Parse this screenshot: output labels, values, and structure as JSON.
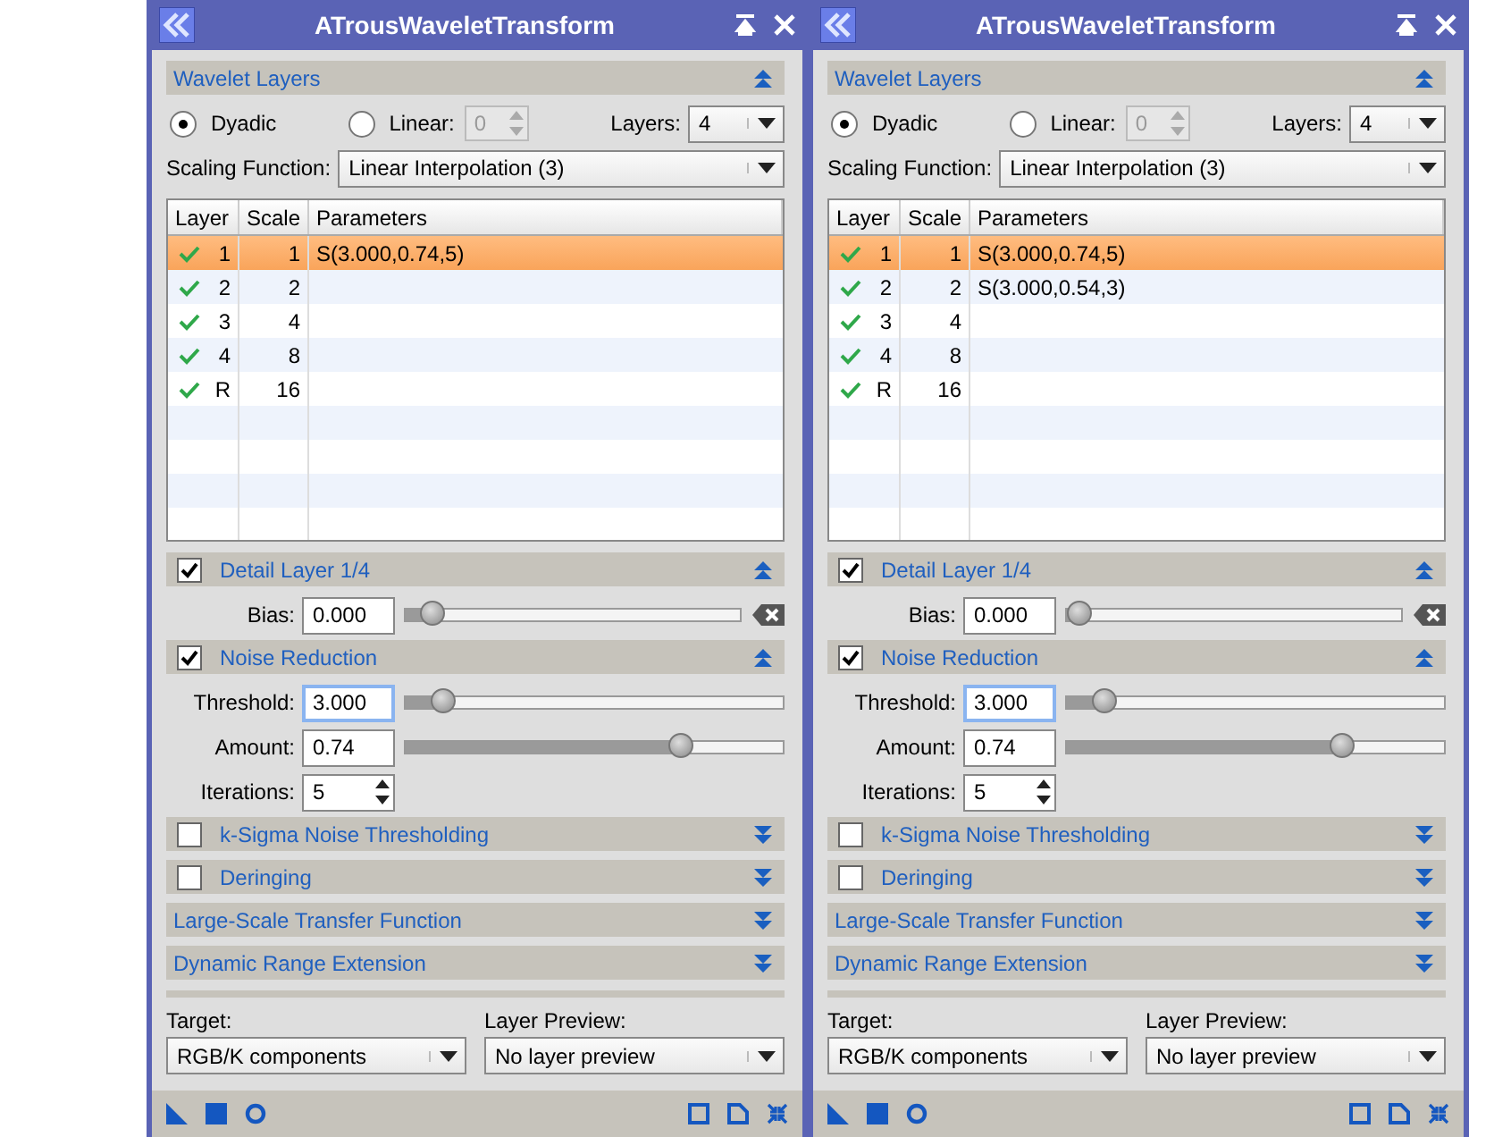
{
  "panels": [
    {
      "title": "ATrousWaveletTransform",
      "wavelet": {
        "title": "Wavelet Layers",
        "expanded": true,
        "radios": [
          {
            "label": "Dyadic",
            "selected": true
          },
          {
            "label": "Linear:",
            "selected": false
          }
        ],
        "linear_value": "0",
        "linear_disabled": true,
        "layers_label": "Layers:",
        "layers_value": "4",
        "scaling_label": "Scaling Function:",
        "scaling_value": "Linear Interpolation (3)"
      },
      "table": {
        "columns": [
          "Layer",
          "Scale",
          "Parameters"
        ],
        "rows": [
          {
            "enabled": true,
            "layer": "1",
            "scale": "1",
            "parameters": "S(3.000,0.74,5)",
            "selected": true
          },
          {
            "enabled": true,
            "layer": "2",
            "scale": "2",
            "selected": false
          },
          {
            "enabled": true,
            "layer": "3",
            "scale": "4",
            "selected": false
          },
          {
            "enabled": true,
            "layer": "4",
            "scale": "8",
            "selected": false
          },
          {
            "enabled": true,
            "layer": "R",
            "scale": "16",
            "selected": false
          }
        ]
      },
      "sections": [
        {
          "title": "Detail Layer 1/4",
          "checked": true,
          "expanded": true,
          "fields": [
            {
              "kind": "slider_reset",
              "label": "Bias:",
              "value": "0.000",
              "level": 0.08,
              "focused": false
            }
          ]
        },
        {
          "title": "Noise Reduction",
          "checked": true,
          "expanded": true,
          "fields": [
            {
              "kind": "slider",
              "label": "Threshold:",
              "value": "3.000",
              "level": 0.1,
              "focused": true
            },
            {
              "kind": "slider",
              "label": "Amount:",
              "value": "0.74",
              "level": 0.73,
              "focused": false
            },
            {
              "kind": "spin",
              "label": "Iterations:",
              "value": "5",
              "focused": false
            }
          ]
        },
        {
          "title": "k-Sigma Noise Thresholding",
          "checked": false,
          "expanded": false
        },
        {
          "title": "Deringing",
          "checked": false,
          "expanded": false
        },
        {
          "title": "Large-Scale Transfer Function",
          "expanded": false
        },
        {
          "title": "Dynamic Range Extension",
          "expanded": false
        }
      ],
      "target": {
        "label": "Target:",
        "value": "RGB/K components"
      },
      "layer_preview": {
        "label": "Layer Preview:",
        "value": "No layer preview"
      }
    },
    {
      "title": "ATrousWaveletTransform",
      "wavelet": {
        "title": "Wavelet Layers",
        "expanded": true,
        "radios": [
          {
            "label": "Dyadic",
            "selected": true
          },
          {
            "label": "Linear:",
            "selected": false
          }
        ],
        "linear_value": "0",
        "linear_disabled": true,
        "layers_label": "Layers:",
        "layers_value": "4",
        "scaling_label": "Scaling Function:",
        "scaling_value": "Linear Interpolation (3)"
      },
      "table": {
        "columns": [
          "Layer",
          "Scale",
          "Parameters"
        ],
        "rows": [
          {
            "enabled": true,
            "layer": "1",
            "scale": "1",
            "parameters": "S(3.000,0.74,5)",
            "selected": true
          },
          {
            "enabled": true,
            "layer": "2",
            "scale": "2",
            "parameters": "S(3.000,0.54,3)",
            "selected": false
          },
          {
            "enabled": true,
            "layer": "3",
            "scale": "4",
            "selected": false
          },
          {
            "enabled": true,
            "layer": "4",
            "scale": "8",
            "selected": false
          },
          {
            "enabled": true,
            "layer": "R",
            "scale": "16",
            "selected": false
          }
        ]
      },
      "sections": [
        {
          "title": "Detail Layer 1/4",
          "checked": true,
          "expanded": true,
          "fields": [
            {
              "kind": "slider_reset",
              "label": "Bias:",
              "value": "0.000",
              "level": 0.04,
              "focused": false
            }
          ]
        },
        {
          "title": "Noise Reduction",
          "checked": true,
          "expanded": true,
          "fields": [
            {
              "kind": "slider",
              "label": "Threshold:",
              "value": "3.000",
              "level": 0.1,
              "focused": true
            },
            {
              "kind": "slider",
              "label": "Amount:",
              "value": "0.74",
              "level": 0.73,
              "focused": false
            },
            {
              "kind": "spin",
              "label": "Iterations:",
              "value": "5",
              "focused": false
            }
          ]
        },
        {
          "title": "k-Sigma Noise Thresholding",
          "checked": false,
          "expanded": false
        },
        {
          "title": "Deringing",
          "checked": false,
          "expanded": false
        },
        {
          "title": "Large-Scale Transfer Function",
          "expanded": false
        },
        {
          "title": "Dynamic Range Extension",
          "expanded": false
        }
      ],
      "target": {
        "label": "Target:",
        "value": "RGB/K components"
      },
      "layer_preview": {
        "label": "Layer Preview:",
        "value": "No layer preview"
      }
    }
  ]
}
